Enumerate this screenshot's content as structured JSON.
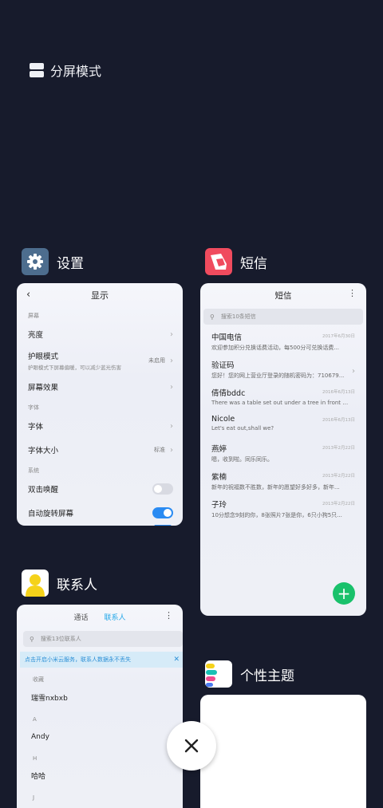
{
  "split_mode": {
    "label": "分屏模式"
  },
  "apps": {
    "settings": {
      "name": "设置",
      "title": "显示",
      "sections": [
        {
          "header": "屏幕"
        },
        {
          "header": "字体"
        },
        {
          "header": "系统"
        }
      ],
      "rows": {
        "brightness": "亮度",
        "eye_care": "护眼模式",
        "eye_care_sub": "护眼模式下屏幕偏暖，可以减少蓝光伤害",
        "eye_care_value": "未启用",
        "screen_effect": "屏幕效果",
        "font": "字体",
        "font_size": "字体大小",
        "font_size_value": "标准",
        "double_tap": "双击唤醒",
        "auto_rotate": "自动旋转屏幕"
      }
    },
    "messages": {
      "name": "短信",
      "title": "短信",
      "search_placeholder": "搜索10条短信",
      "items": [
        {
          "name": "中国电信",
          "date": "2017年6月30日",
          "preview": "欢迎参加积分兑换话费活动，每500分可兑换话费..."
        },
        {
          "name": "验证码",
          "date": "",
          "preview": "您好！您的网上营业厅登录的随机密码为：710679..."
        },
        {
          "name": "倩倩bddc",
          "date": "2016年6月13日",
          "preview": "There was a table set out under a tree in front o..."
        },
        {
          "name": "Nicole",
          "date": "2016年6月13日",
          "preview": "Let's eat out,shall we?"
        },
        {
          "name": "燕婷",
          "date": "2013年2月22日",
          "preview": "嗯，收到啦。同乐同乐。"
        },
        {
          "name": "紫楠",
          "date": "2013年2月22日",
          "preview": "新年的祝福数不胜数，新年的愿望好多好多，新年..."
        },
        {
          "name": "子玲",
          "date": "2013年2月22日",
          "preview": "10分想念9刻的你，8张照片7张是你，6只小狗5只..."
        }
      ]
    },
    "contacts": {
      "name": "联系人",
      "tab_calls": "通话",
      "tab_contacts": "联系人",
      "search_placeholder": "搜索13位联系人",
      "banner": "点击开启小米云服务，联系人数据永不丢失",
      "groups": [
        {
          "header": "收藏",
          "entries": [
            "瑞雪nxbxb"
          ]
        },
        {
          "header": "A",
          "entries": [
            "Andy"
          ]
        },
        {
          "header": "H",
          "entries": [
            "哈哈"
          ]
        },
        {
          "header": "J",
          "entries": []
        }
      ]
    },
    "themes": {
      "name": "个性主题"
    }
  },
  "colors": {
    "background": "#171b2c",
    "accent_blue": "#2a8bf2",
    "fab_green": "#19c16b",
    "messages_icon": "#f04b5e"
  }
}
